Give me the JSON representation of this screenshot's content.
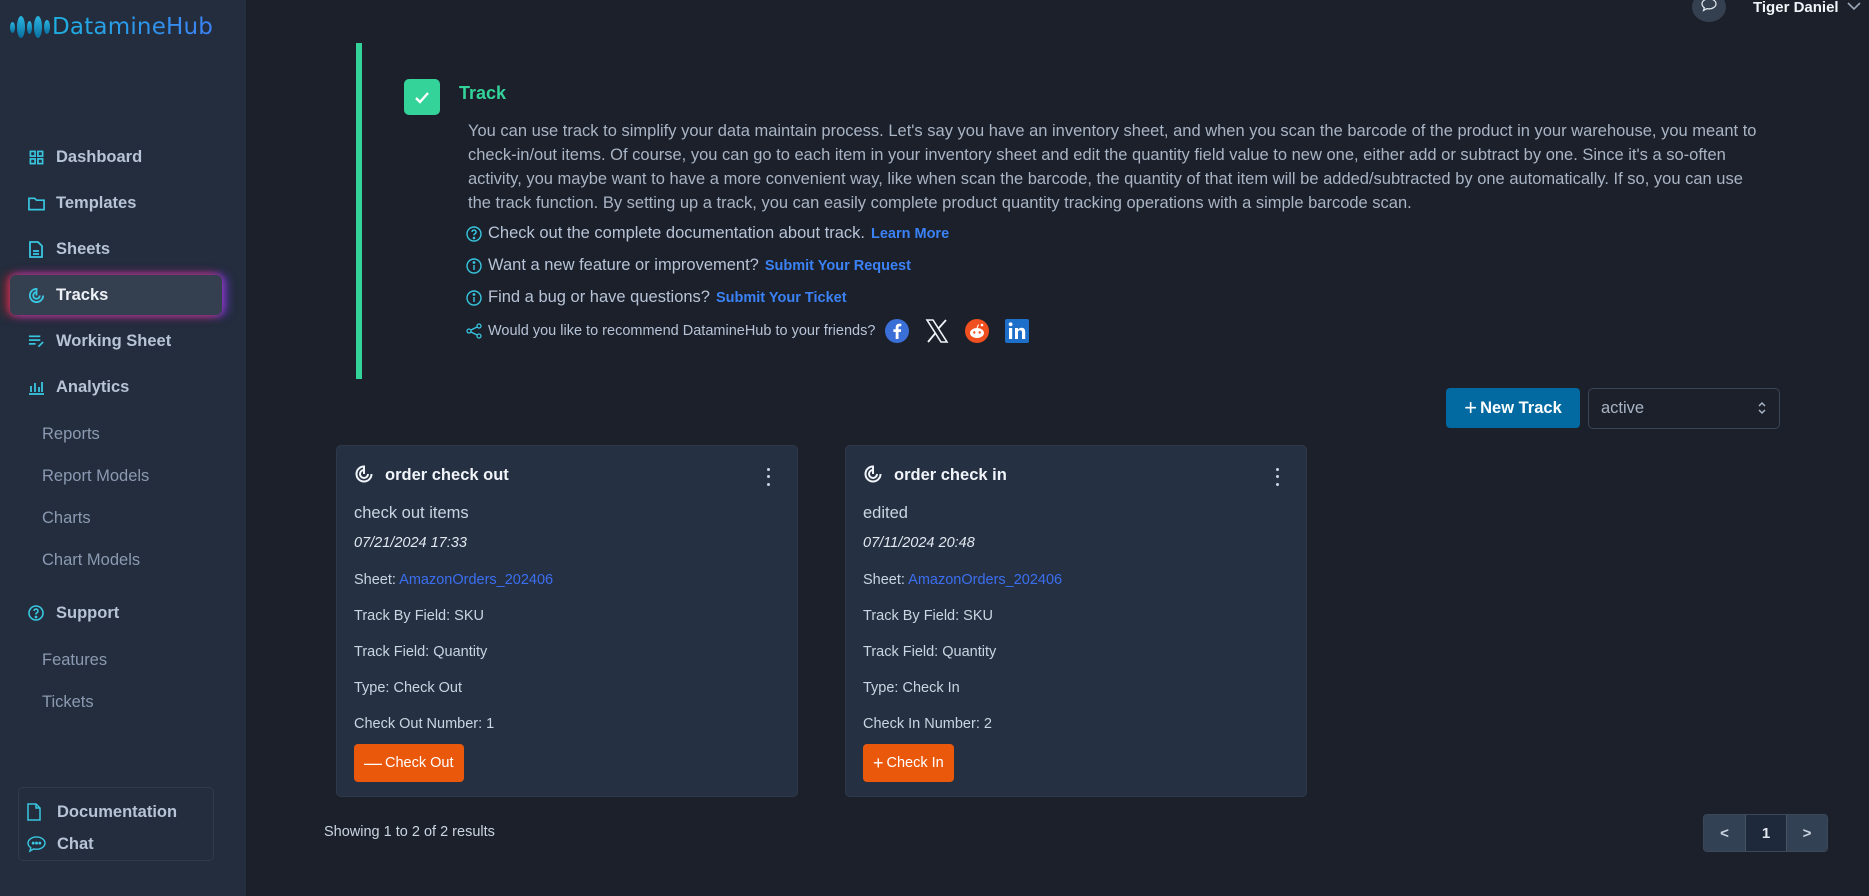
{
  "app": {
    "brand": "DatamineHub"
  },
  "header": {
    "user_name": "Tiger Daniel"
  },
  "sidebar": {
    "items": [
      {
        "label": "Dashboard",
        "icon": "grid-icon"
      },
      {
        "label": "Templates",
        "icon": "folder-icon"
      },
      {
        "label": "Sheets",
        "icon": "document-icon"
      },
      {
        "label": "Tracks",
        "icon": "radar-icon",
        "active": true
      },
      {
        "label": "Working Sheet",
        "icon": "edit-list-icon"
      },
      {
        "label": "Analytics",
        "icon": "bar-chart-icon"
      }
    ],
    "analytics_sub": [
      "Reports",
      "Report Models",
      "Charts",
      "Chart Models"
    ],
    "support": {
      "label": "Support",
      "icon": "help-circle-icon"
    },
    "support_sub": [
      "Features",
      "Tickets"
    ],
    "bottom": [
      {
        "label": "Documentation",
        "icon": "file-icon"
      },
      {
        "label": "Chat",
        "icon": "chat-icon"
      }
    ]
  },
  "info": {
    "title": "Track",
    "description": "You can use track to simplify your data maintain process. Let's say you have an inventory sheet, and when you scan the barcode of the product in your warehouse, you meant to check-in/out items. Of course, you can go to each item in your inventory sheet and edit the quantity field value to new one, either add or subtract by one. Since it's a so-often activity, you maybe want to have a more convenient way, like when scan the barcode, the quantity of that item will be added/subtracted by one automatically. If so, you can use the track function. By setting up a track, you can easily complete product quantity tracking operations with a simple barcode scan.",
    "doc_text": "Check out the complete documentation about track.",
    "doc_link": "Learn More",
    "feature_text": "Want a new feature or improvement?",
    "feature_link": "Submit Your Request",
    "bug_text": "Find a bug or have questions?",
    "bug_link": "Submit Your Ticket",
    "share_text": "Would you like to recommend DatamineHub to your friends?",
    "social": [
      "facebook",
      "x",
      "reddit",
      "linkedin"
    ]
  },
  "controls": {
    "new_track_label": "New Track",
    "status_filter_value": "active"
  },
  "tracks": [
    {
      "title": "order check out",
      "description": "check out items",
      "date": "07/21/2024 17:33",
      "sheet_label": "Sheet: ",
      "sheet": "AmazonOrders_202406",
      "track_by_field": "Track By Field: SKU",
      "track_field": "Track Field: Quantity",
      "type": "Type: Check Out",
      "number": "Check Out Number: 1",
      "button": "Check Out",
      "button_symbol": "—"
    },
    {
      "title": "order check in",
      "description": "edited",
      "date": "07/11/2024 20:48",
      "sheet_label": "Sheet: ",
      "sheet": "AmazonOrders_202406",
      "track_by_field": "Track By Field: SKU",
      "track_field": "Track Field: Quantity",
      "type": "Type: Check In",
      "number": "Check In Number: 2",
      "button": "Check In",
      "button_symbol": "+"
    }
  ],
  "pagination": {
    "summary": "Showing 1 to 2 of 2 results",
    "prev": "<",
    "current": "1",
    "next": ">"
  },
  "colors": {
    "accent_green": "#34d399",
    "primary_blue": "#0369a1",
    "action_orange": "#ea580c",
    "link_blue": "#3b82f6"
  }
}
